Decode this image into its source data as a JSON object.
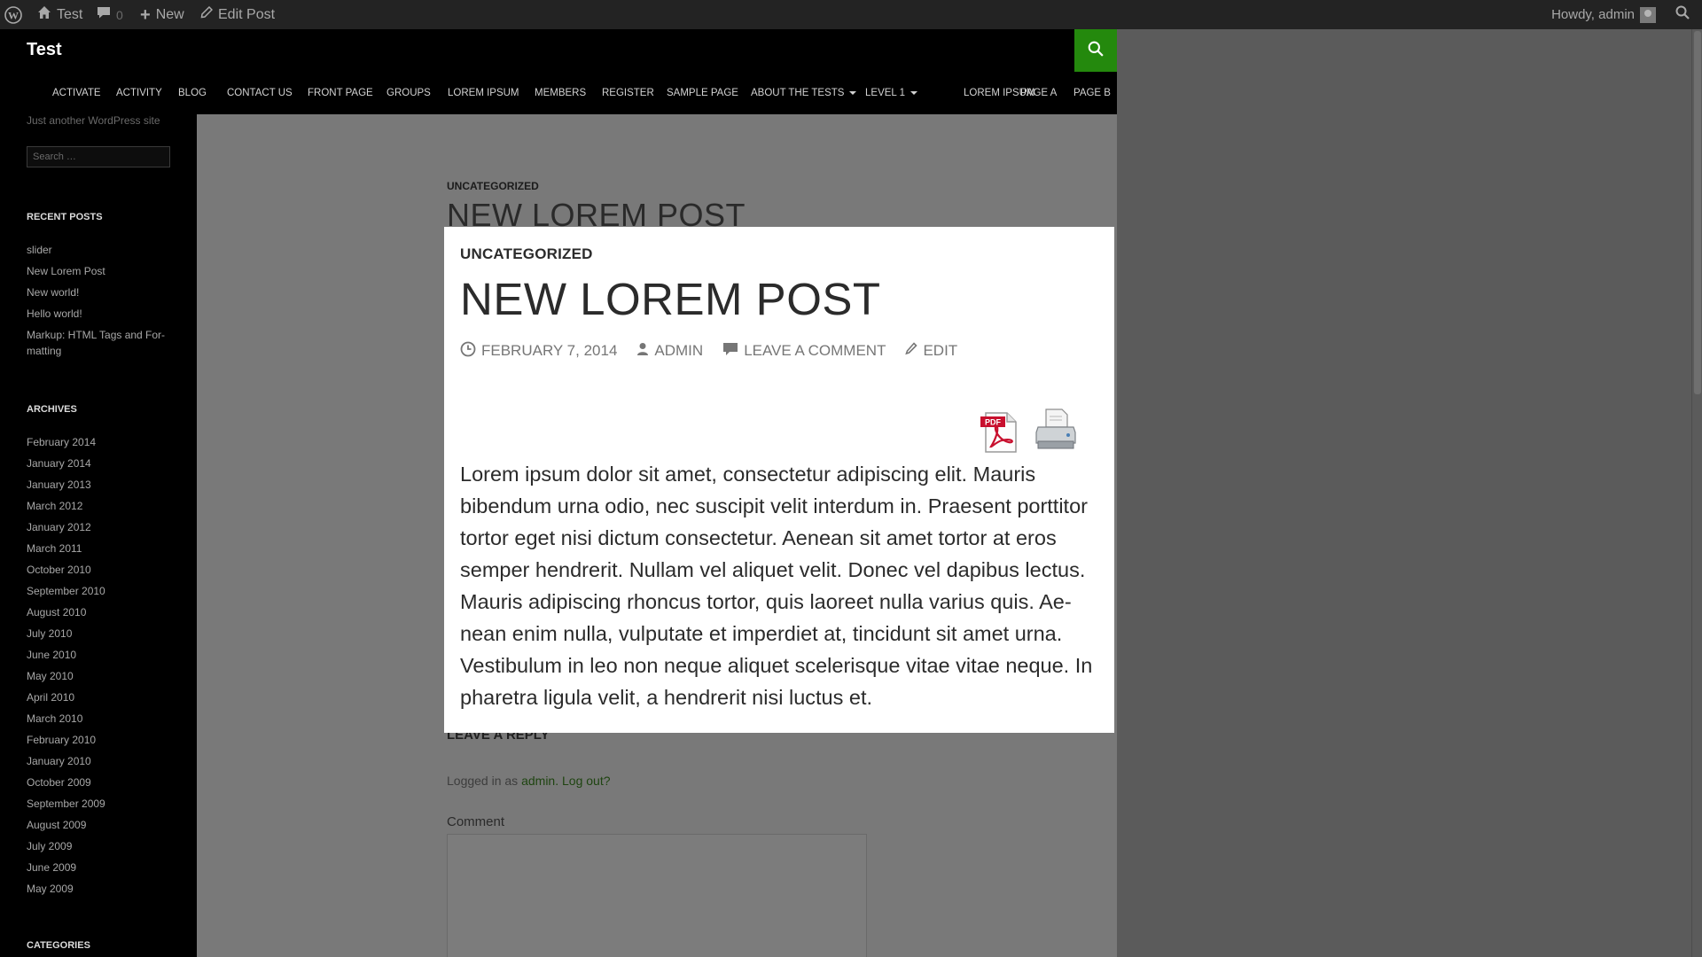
{
  "admin_bar": {
    "site_name": "Test",
    "comment_count": "0",
    "new_label": "New",
    "edit_post_label": "Edit Post",
    "howdy": "Howdy, admin"
  },
  "header": {
    "site_title": "Test",
    "accent_color": "#24890d",
    "nav": [
      "ACTIVATE",
      "ACTIVITY",
      "BLOG",
      "CONTACT US",
      "FRONT PAGE",
      "GROUPS",
      "LOREM IPSUM",
      "MEMBERS",
      "REGISTER",
      "SAMPLE PAGE",
      "ABOUT THE TESTS",
      "LEVEL 1",
      "LOREM IPSUM",
      "PAGE A",
      "PAGE B"
    ]
  },
  "sidebar": {
    "tagline": "Just another WordPress site",
    "search_placeholder": "Search …",
    "recent_posts_title": "RECENT POSTS",
    "recent_posts": [
      "slider",
      "New Lorem Post",
      "New world!",
      "Hello world!",
      "Markup: HTML Tags and For-matting"
    ],
    "archives_title": "ARCHIVES",
    "archives": [
      "February 2014",
      "January 2014",
      "January 2013",
      "March 2012",
      "January 2012",
      "March 2011",
      "October 2010",
      "September 2010",
      "August 2010",
      "July 2010",
      "June 2010",
      "May 2010",
      "April 2010",
      "March 2010",
      "February 2010",
      "January 2010",
      "October 2009",
      "September 2009",
      "August 2009",
      "July 2009",
      "June 2009",
      "May 2009"
    ],
    "categories_title": "CATEGORIES"
  },
  "content": {
    "category": "UNCATEGORIZED",
    "title": "NEW LOREM POST",
    "leave_reply": "LEAVE A REPLY",
    "logged_in_prefix": "Logged in as",
    "logged_in_user": "admin",
    "logout": "Log out?",
    "comment_label": "Comment"
  },
  "modal": {
    "category": "UNCATEGORIZED",
    "title": "NEW LOREM POST",
    "date": "FEBRUARY 7, 2014",
    "author": "ADMIN",
    "comment_link": "LEAVE A COMMENT",
    "edit_link": "EDIT",
    "body": "Lorem ipsum dolor sit amet, consectetur adipiscing elit. Mauris bibendum urna odio, nec suscipit velit interdum in. Praesent porttitor tortor eget nisi dictum consectetur. Aenean sit amet tortor at eros semper hendrerit. Nullam vel aliquet velit. Donec vel dapibus lectus. Mauris adipiscing rhoncus tortor, quis laoreet nulla varius quis. Ae-nean enim nulla, vulputate et imperdiet at, tincidunt sit amet urna. Vestibulum in leo non neque aliquet scelerisque vitae vitae neque. In pharetra ligula velit, a hendrerit nisi luctus et."
  }
}
